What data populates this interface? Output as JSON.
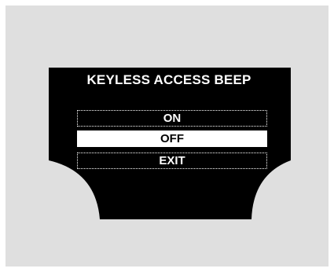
{
  "screen": {
    "title": "KEYLESS ACCESS BEEP",
    "selected_option": "OFF"
  },
  "menu": {
    "options": [
      {
        "label": "ON",
        "selected": false
      },
      {
        "label": "OFF",
        "selected": true
      },
      {
        "label": "EXIT",
        "selected": false
      }
    ]
  },
  "colors": {
    "frame_background": "#dfdfdf",
    "display_background": "#000000",
    "text": "#ffffff",
    "selected_background": "#ffffff",
    "selected_text": "#000000"
  }
}
